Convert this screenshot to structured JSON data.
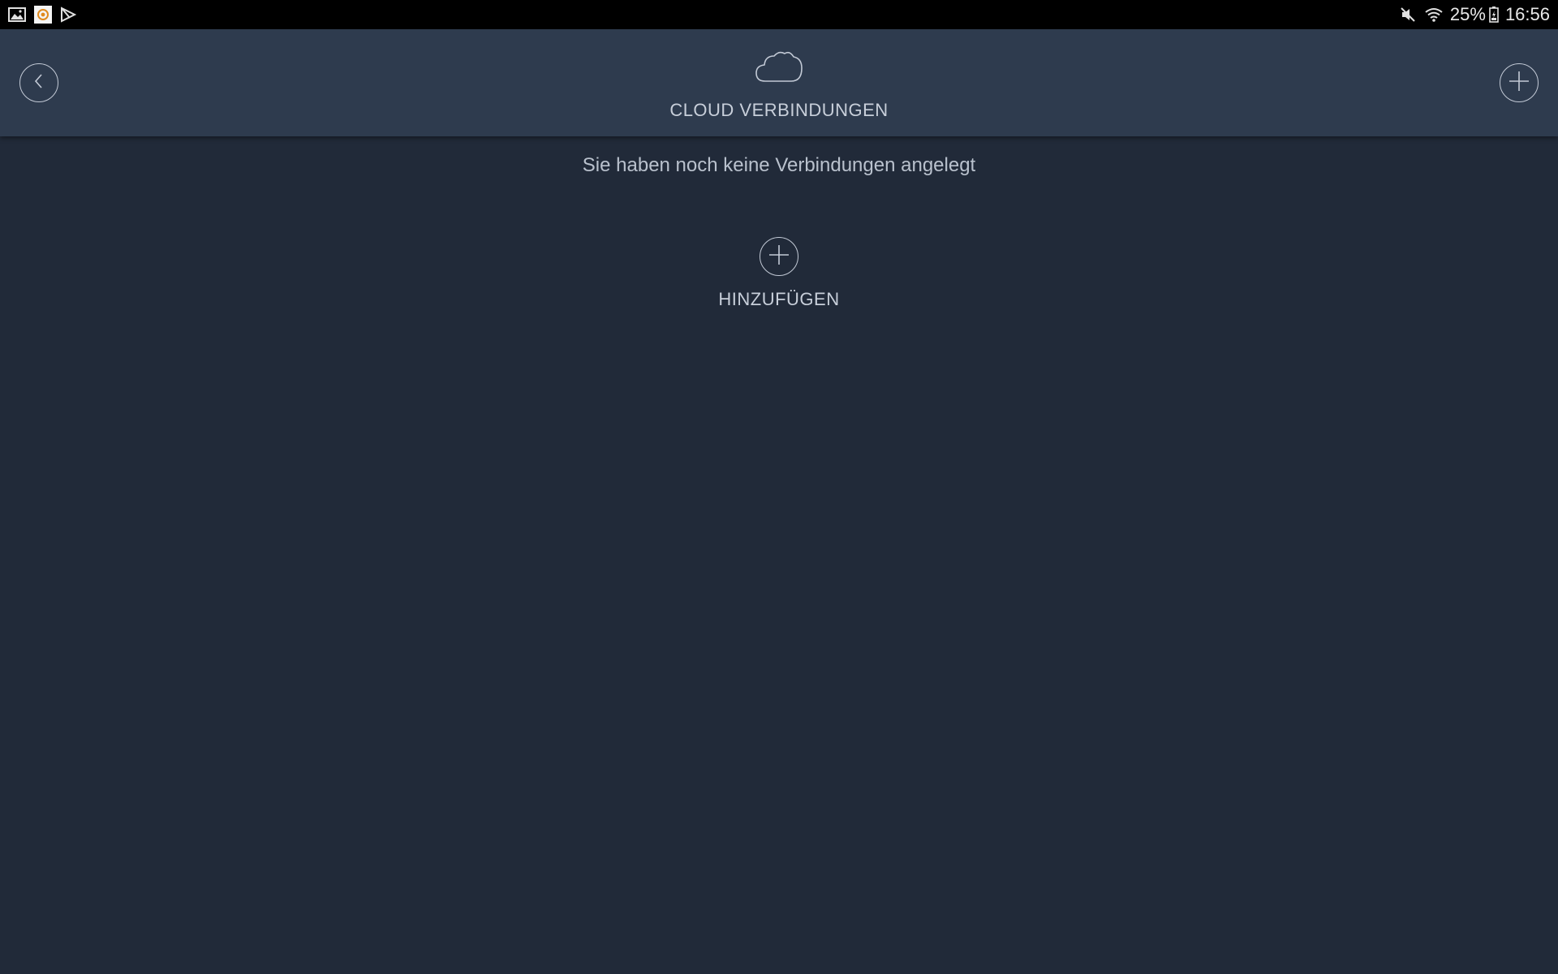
{
  "status_bar": {
    "left_icons": [
      "gallery-icon",
      "app-notification-icon",
      "store-icon"
    ],
    "right_icons": [
      "mute-icon",
      "wifi-icon",
      "battery-icon"
    ],
    "battery": "25%",
    "time": "16:56"
  },
  "header": {
    "title": "CLOUD VERBINDUNGEN",
    "icon": "cloud-icon",
    "back_icon": "chevron-left-icon",
    "add_icon": "plus-icon"
  },
  "main": {
    "empty_message": "Sie haben noch keine Verbindungen angelegt",
    "add_label": "HINZUFÜGEN"
  },
  "colors": {
    "background": "#212a39",
    "header": "#2e3b4e",
    "text": "#c3cad6",
    "status_bar": "#000000"
  }
}
